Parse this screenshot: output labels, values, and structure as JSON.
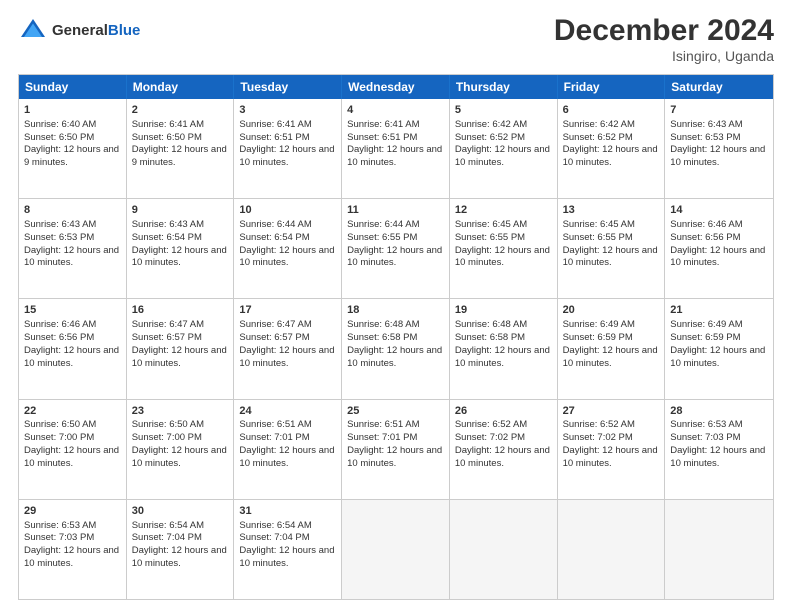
{
  "header": {
    "logo_general": "General",
    "logo_blue": "Blue",
    "month": "December 2024",
    "location": "Isingiro, Uganda"
  },
  "days_of_week": [
    "Sunday",
    "Monday",
    "Tuesday",
    "Wednesday",
    "Thursday",
    "Friday",
    "Saturday"
  ],
  "weeks": [
    [
      {
        "day": "1",
        "sunrise": "Sunrise: 6:40 AM",
        "sunset": "Sunset: 6:50 PM",
        "daylight": "Daylight: 12 hours and 9 minutes."
      },
      {
        "day": "2",
        "sunrise": "Sunrise: 6:41 AM",
        "sunset": "Sunset: 6:50 PM",
        "daylight": "Daylight: 12 hours and 9 minutes."
      },
      {
        "day": "3",
        "sunrise": "Sunrise: 6:41 AM",
        "sunset": "Sunset: 6:51 PM",
        "daylight": "Daylight: 12 hours and 10 minutes."
      },
      {
        "day": "4",
        "sunrise": "Sunrise: 6:41 AM",
        "sunset": "Sunset: 6:51 PM",
        "daylight": "Daylight: 12 hours and 10 minutes."
      },
      {
        "day": "5",
        "sunrise": "Sunrise: 6:42 AM",
        "sunset": "Sunset: 6:52 PM",
        "daylight": "Daylight: 12 hours and 10 minutes."
      },
      {
        "day": "6",
        "sunrise": "Sunrise: 6:42 AM",
        "sunset": "Sunset: 6:52 PM",
        "daylight": "Daylight: 12 hours and 10 minutes."
      },
      {
        "day": "7",
        "sunrise": "Sunrise: 6:43 AM",
        "sunset": "Sunset: 6:53 PM",
        "daylight": "Daylight: 12 hours and 10 minutes."
      }
    ],
    [
      {
        "day": "8",
        "sunrise": "Sunrise: 6:43 AM",
        "sunset": "Sunset: 6:53 PM",
        "daylight": "Daylight: 12 hours and 10 minutes."
      },
      {
        "day": "9",
        "sunrise": "Sunrise: 6:43 AM",
        "sunset": "Sunset: 6:54 PM",
        "daylight": "Daylight: 12 hours and 10 minutes."
      },
      {
        "day": "10",
        "sunrise": "Sunrise: 6:44 AM",
        "sunset": "Sunset: 6:54 PM",
        "daylight": "Daylight: 12 hours and 10 minutes."
      },
      {
        "day": "11",
        "sunrise": "Sunrise: 6:44 AM",
        "sunset": "Sunset: 6:55 PM",
        "daylight": "Daylight: 12 hours and 10 minutes."
      },
      {
        "day": "12",
        "sunrise": "Sunrise: 6:45 AM",
        "sunset": "Sunset: 6:55 PM",
        "daylight": "Daylight: 12 hours and 10 minutes."
      },
      {
        "day": "13",
        "sunrise": "Sunrise: 6:45 AM",
        "sunset": "Sunset: 6:55 PM",
        "daylight": "Daylight: 12 hours and 10 minutes."
      },
      {
        "day": "14",
        "sunrise": "Sunrise: 6:46 AM",
        "sunset": "Sunset: 6:56 PM",
        "daylight": "Daylight: 12 hours and 10 minutes."
      }
    ],
    [
      {
        "day": "15",
        "sunrise": "Sunrise: 6:46 AM",
        "sunset": "Sunset: 6:56 PM",
        "daylight": "Daylight: 12 hours and 10 minutes."
      },
      {
        "day": "16",
        "sunrise": "Sunrise: 6:47 AM",
        "sunset": "Sunset: 6:57 PM",
        "daylight": "Daylight: 12 hours and 10 minutes."
      },
      {
        "day": "17",
        "sunrise": "Sunrise: 6:47 AM",
        "sunset": "Sunset: 6:57 PM",
        "daylight": "Daylight: 12 hours and 10 minutes."
      },
      {
        "day": "18",
        "sunrise": "Sunrise: 6:48 AM",
        "sunset": "Sunset: 6:58 PM",
        "daylight": "Daylight: 12 hours and 10 minutes."
      },
      {
        "day": "19",
        "sunrise": "Sunrise: 6:48 AM",
        "sunset": "Sunset: 6:58 PM",
        "daylight": "Daylight: 12 hours and 10 minutes."
      },
      {
        "day": "20",
        "sunrise": "Sunrise: 6:49 AM",
        "sunset": "Sunset: 6:59 PM",
        "daylight": "Daylight: 12 hours and 10 minutes."
      },
      {
        "day": "21",
        "sunrise": "Sunrise: 6:49 AM",
        "sunset": "Sunset: 6:59 PM",
        "daylight": "Daylight: 12 hours and 10 minutes."
      }
    ],
    [
      {
        "day": "22",
        "sunrise": "Sunrise: 6:50 AM",
        "sunset": "Sunset: 7:00 PM",
        "daylight": "Daylight: 12 hours and 10 minutes."
      },
      {
        "day": "23",
        "sunrise": "Sunrise: 6:50 AM",
        "sunset": "Sunset: 7:00 PM",
        "daylight": "Daylight: 12 hours and 10 minutes."
      },
      {
        "day": "24",
        "sunrise": "Sunrise: 6:51 AM",
        "sunset": "Sunset: 7:01 PM",
        "daylight": "Daylight: 12 hours and 10 minutes."
      },
      {
        "day": "25",
        "sunrise": "Sunrise: 6:51 AM",
        "sunset": "Sunset: 7:01 PM",
        "daylight": "Daylight: 12 hours and 10 minutes."
      },
      {
        "day": "26",
        "sunrise": "Sunrise: 6:52 AM",
        "sunset": "Sunset: 7:02 PM",
        "daylight": "Daylight: 12 hours and 10 minutes."
      },
      {
        "day": "27",
        "sunrise": "Sunrise: 6:52 AM",
        "sunset": "Sunset: 7:02 PM",
        "daylight": "Daylight: 12 hours and 10 minutes."
      },
      {
        "day": "28",
        "sunrise": "Sunrise: 6:53 AM",
        "sunset": "Sunset: 7:03 PM",
        "daylight": "Daylight: 12 hours and 10 minutes."
      }
    ],
    [
      {
        "day": "29",
        "sunrise": "Sunrise: 6:53 AM",
        "sunset": "Sunset: 7:03 PM",
        "daylight": "Daylight: 12 hours and 10 minutes."
      },
      {
        "day": "30",
        "sunrise": "Sunrise: 6:54 AM",
        "sunset": "Sunset: 7:04 PM",
        "daylight": "Daylight: 12 hours and 10 minutes."
      },
      {
        "day": "31",
        "sunrise": "Sunrise: 6:54 AM",
        "sunset": "Sunset: 7:04 PM",
        "daylight": "Daylight: 12 hours and 10 minutes."
      },
      null,
      null,
      null,
      null
    ]
  ]
}
